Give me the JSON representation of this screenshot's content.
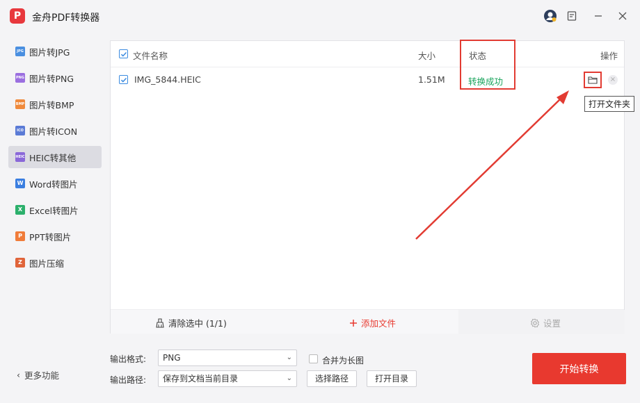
{
  "app": {
    "title": "金舟PDF转换器",
    "logo_text": "P"
  },
  "sidebar": {
    "items": [
      {
        "label": "图片转JPG",
        "icon": "JPG",
        "color": "#4a8fe0"
      },
      {
        "label": "图片转PNG",
        "icon": "PNG",
        "color": "#9b6fe0"
      },
      {
        "label": "图片转BMP",
        "icon": "BMP",
        "color": "#f08a3c"
      },
      {
        "label": "图片转ICON",
        "icon": "ICO",
        "color": "#5b7bd6"
      },
      {
        "label": "HEIC转其他",
        "icon": "HEIC",
        "color": "#8a68d8"
      },
      {
        "label": "Word转图片",
        "icon": "W",
        "color": "#3a7ee0"
      },
      {
        "label": "Excel转图片",
        "icon": "X",
        "color": "#2cb06c"
      },
      {
        "label": "PPT转图片",
        "icon": "P",
        "color": "#f07c3a"
      },
      {
        "label": "图片压缩",
        "icon": "Z",
        "color": "#e0643a"
      }
    ],
    "active_index": 4,
    "more_label": "更多功能"
  },
  "table": {
    "headers": {
      "name": "文件名称",
      "size": "大小",
      "status": "状态",
      "action": "操作"
    },
    "rows": [
      {
        "name": "IMG_5844.HEIC",
        "size": "1.51M",
        "status": "转换成功"
      }
    ],
    "tooltip": "打开文件夹"
  },
  "panel_footer": {
    "clear": "清除选中 (1/1)",
    "add": "添加文件",
    "settings": "设置"
  },
  "output": {
    "format_label": "输出格式:",
    "format_value": "PNG",
    "merge_label": "合并为长图",
    "path_label": "输出路径:",
    "path_value": "保存到文档当前目录",
    "choose_path": "选择路径",
    "open_dir": "打开目录",
    "start": "开始转换"
  },
  "colors": {
    "accent": "#e8392f",
    "success": "#1aa45c",
    "checkbox": "#3b8be0"
  }
}
